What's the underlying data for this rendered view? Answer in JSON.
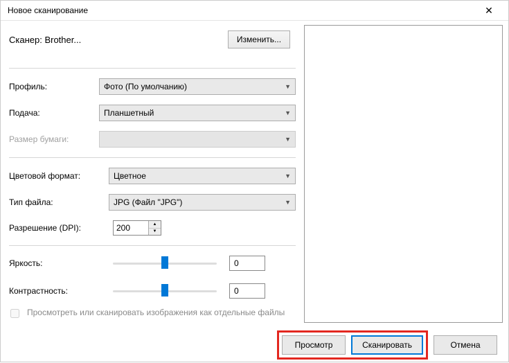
{
  "window": {
    "title": "Новое сканирование"
  },
  "scanner": {
    "label": "Сканер: Brother...",
    "change_btn": "Изменить..."
  },
  "profile": {
    "label": "Профиль:",
    "value": "Фото (По умолчанию)"
  },
  "feed": {
    "label": "Подача:",
    "value": "Планшетный"
  },
  "paper": {
    "label": "Размер бумаги:",
    "value": ""
  },
  "colorfmt": {
    "label": "Цветовой формат:",
    "value": "Цветное"
  },
  "filetype": {
    "label": "Тип файла:",
    "value": "JPG (Файл \"JPG\")"
  },
  "dpi": {
    "label": "Разрешение (DPI):",
    "value": "200"
  },
  "brightness": {
    "label": "Яркость:",
    "value": "0"
  },
  "contrast": {
    "label": "Контрастность:",
    "value": "0"
  },
  "separate": {
    "label": "Просмотреть или сканировать изображения как отдельные файлы"
  },
  "footer": {
    "preview": "Просмотр",
    "scan": "Сканировать",
    "cancel": "Отмена"
  }
}
